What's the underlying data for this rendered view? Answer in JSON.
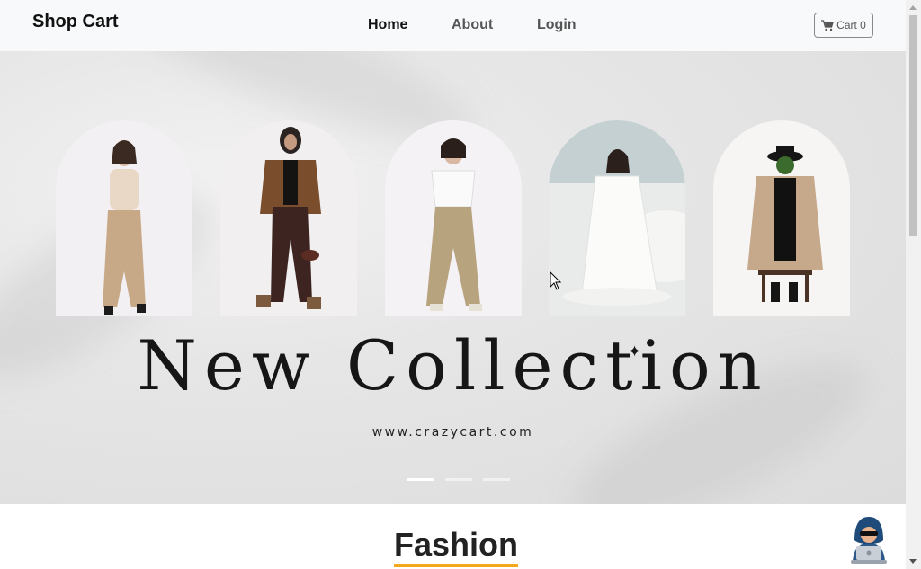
{
  "navbar": {
    "brand": "Shop Cart",
    "links": [
      {
        "label": "Home",
        "active": true
      },
      {
        "label": "About",
        "active": false
      },
      {
        "label": "Login",
        "active": false
      }
    ],
    "cart": {
      "icon": "cart-icon",
      "label": "Cart 0"
    }
  },
  "hero": {
    "title": "New Collection",
    "url": "www.crazycart.com",
    "carousel": {
      "slides": 3,
      "active_index": 0
    },
    "models": [
      {
        "name": "model-beige-knit-dress"
      },
      {
        "name": "model-brown-leather-jacket"
      },
      {
        "name": "model-white-tee-cargo-pants"
      },
      {
        "name": "model-white-dress-seated"
      },
      {
        "name": "model-trench-coat-hat"
      }
    ]
  },
  "section": {
    "title": "Fashion"
  },
  "colors": {
    "accent": "#f4a81d",
    "navbar_bg": "#f8f9fa"
  },
  "floating": {
    "icon": "hacker-avatar-icon"
  }
}
